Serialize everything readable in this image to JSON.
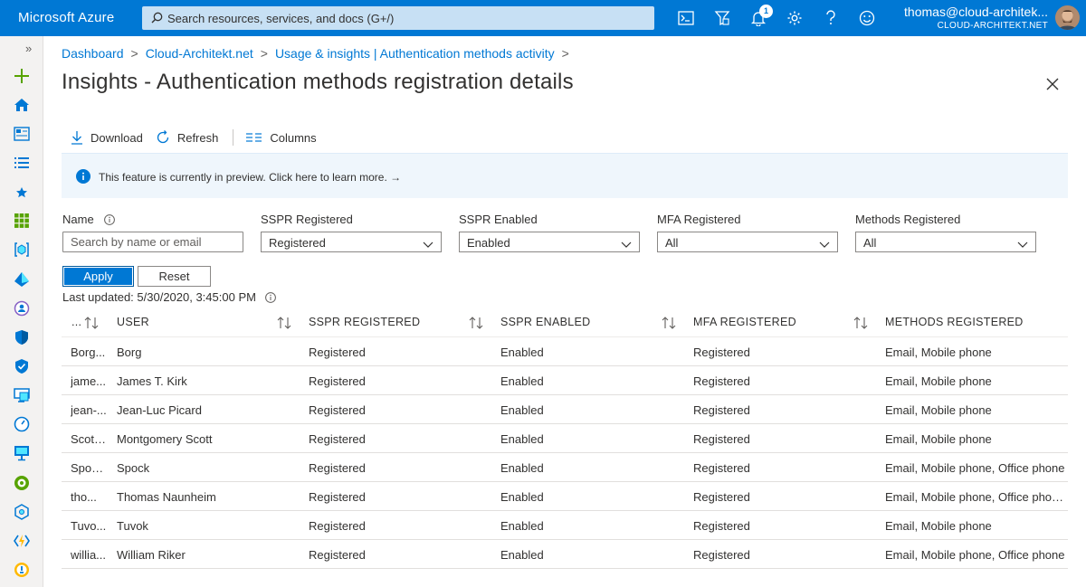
{
  "app": {
    "brand": "Microsoft Azure"
  },
  "search": {
    "placeholder": "Search resources, services, and docs (G+/)"
  },
  "topbar": {
    "notification_count": "1"
  },
  "account": {
    "email": "thomas@cloud-architek...",
    "tenant": "CLOUD-ARCHITEKT.NET"
  },
  "nav": {
    "collapse": "»"
  },
  "breadcrumb": {
    "items": [
      "Dashboard",
      "Cloud-Architekt.net",
      "Usage & insights | Authentication methods activity"
    ],
    "separator": ">"
  },
  "page": {
    "title": "Insights - Authentication methods registration details"
  },
  "toolbar": {
    "download": "Download",
    "refresh": "Refresh",
    "columns": "Columns"
  },
  "banner": {
    "text": "This feature is currently in preview. Click here to learn more. →"
  },
  "filters": {
    "name": {
      "label": "Name",
      "placeholder": "Search by name or email"
    },
    "sspr_registered": {
      "label": "SSPR Registered",
      "value": "Registered"
    },
    "sspr_enabled": {
      "label": "SSPR Enabled",
      "value": "Enabled"
    },
    "mfa_registered": {
      "label": "MFA Registered",
      "value": "All"
    },
    "methods_registered": {
      "label": "Methods Registered",
      "value": "All"
    }
  },
  "actions": {
    "apply": "Apply",
    "reset": "Reset"
  },
  "last_updated": "Last updated: 5/30/2020, 3:45:00 PM",
  "table": {
    "columns": [
      "...",
      "USER",
      "SSPR REGISTERED",
      "SSPR ENABLED",
      "MFA REGISTERED",
      "METHODS REGISTERED"
    ],
    "rows": [
      [
        "Borg...",
        "Borg",
        "Registered",
        "Enabled",
        "Registered",
        "Email, Mobile phone"
      ],
      [
        "jame...",
        "James T. Kirk",
        "Registered",
        "Enabled",
        "Registered",
        "Email, Mobile phone"
      ],
      [
        "jean-...",
        "Jean-Luc Picard",
        "Registered",
        "Enabled",
        "Registered",
        "Email, Mobile phone"
      ],
      [
        "Scott...",
        "Montgomery Scott",
        "Registered",
        "Enabled",
        "Registered",
        "Email, Mobile phone"
      ],
      [
        "Spoc...",
        "Spock",
        "Registered",
        "Enabled",
        "Registered",
        "Email, Mobile phone, Office phone"
      ],
      [
        "tho...",
        "Thomas Naunheim",
        "Registered",
        "Enabled",
        "Registered",
        "Email, Mobile phone, Office phon..."
      ],
      [
        "Tuvo...",
        "Tuvok",
        "Registered",
        "Enabled",
        "Registered",
        "Email, Mobile phone"
      ],
      [
        "willia...",
        "William Riker",
        "Registered",
        "Enabled",
        "Registered",
        "Email, Mobile phone, Office phone"
      ]
    ]
  },
  "colors": {
    "brand_blue": "#0078d4",
    "banner_bg": "#eff6fc",
    "search_bg": "#c7e0f4"
  }
}
